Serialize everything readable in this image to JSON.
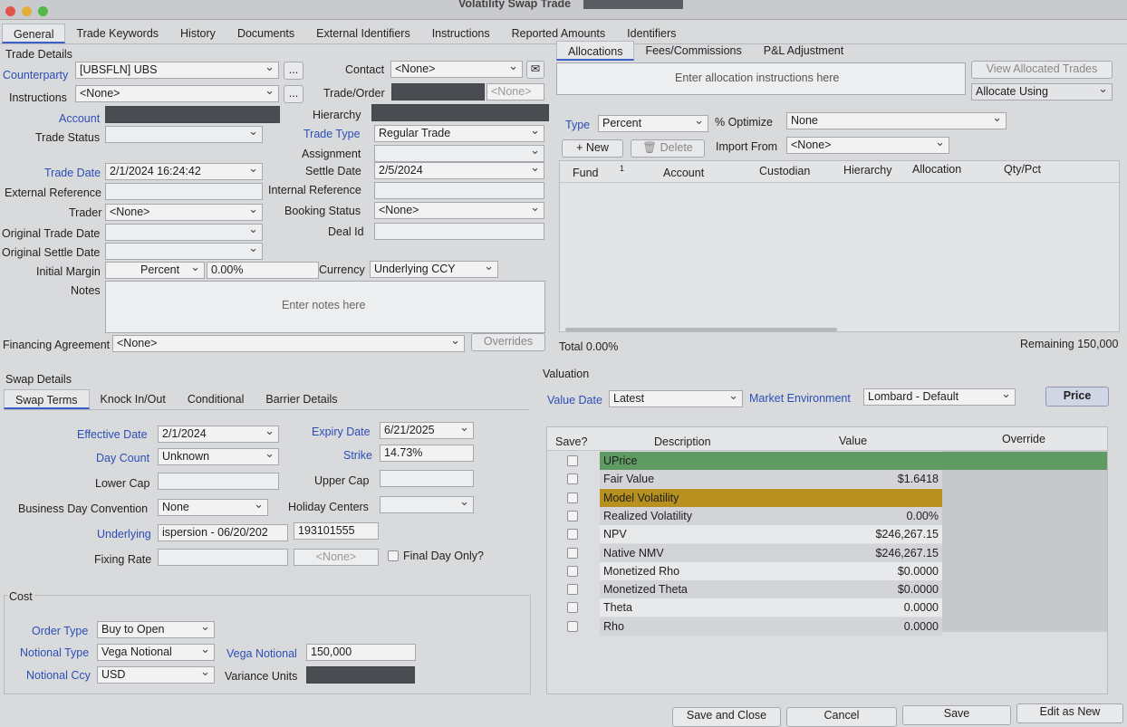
{
  "window": {
    "title": "Volatility Swap Trade"
  },
  "tabs": [
    "General",
    "Trade Keywords",
    "History",
    "Documents",
    "External Identifiers",
    "Instructions",
    "Reported Amounts",
    "Identifiers"
  ],
  "trade_details": {
    "section_title": "Trade Details",
    "counterparty_label": "Counterparty",
    "counterparty": "[UBSFLN] UBS",
    "contact_label": "Contact",
    "contact": "<None>",
    "instructions_label": "Instructions",
    "instructions": "<None>",
    "trade_order_label": "Trade/Order",
    "trade_order": "<None>",
    "account_label": "Account",
    "hierarchy_label": "Hierarchy",
    "trade_status_label": "Trade Status",
    "trade_type_label": "Trade Type",
    "trade_type": "Regular Trade",
    "assignment_label": "Assignment",
    "trade_date_label": "Trade Date",
    "trade_date": "2/1/2024 16:24:42",
    "settle_date_label": "Settle Date",
    "settle_date": "2/5/2024",
    "external_ref_label": "External Reference",
    "internal_ref_label": "Internal Reference",
    "trader_label": "Trader",
    "trader": "<None>",
    "booking_status_label": "Booking Status",
    "booking_status": "<None>",
    "original_trade_date_label": "Original Trade Date",
    "deal_id_label": "Deal Id",
    "original_settle_date_label": "Original Settle Date",
    "initial_margin_label": "Initial Margin",
    "initial_margin_type": "Percent",
    "initial_margin_value": "0.00%",
    "currency_label": "Currency",
    "currency": "Underlying CCY",
    "notes_label": "Notes",
    "notes_placeholder": "Enter notes here",
    "financing_label": "Financing Agreement",
    "financing": "<None>",
    "overrides_button": "Overrides",
    "ellipsis": "..."
  },
  "allocations": {
    "tabs": [
      "Allocations",
      "Fees/Commissions",
      "P&L Adjustment"
    ],
    "instructions_placeholder": "Enter allocation instructions here",
    "view_allocated_button": "View Allocated Trades",
    "allocate_using": "Allocate Using",
    "type_label": "Type",
    "type": "Percent",
    "optimize_label": "% Optimize",
    "optimize": "None",
    "new_button": "+ New",
    "delete_button": "Delete",
    "import_from_label": "Import From",
    "import_from": "<None>",
    "columns": [
      "Fund",
      "Account",
      "Custodian",
      "Hierarchy",
      "Allocation",
      "Qty/Pct"
    ],
    "sort_indicator": "1",
    "total": "Total 0.00%",
    "remaining": "Remaining 150,000"
  },
  "swap_details": {
    "section_title": "Swap Details",
    "tabs": [
      "Swap Terms",
      "Knock In/Out",
      "Conditional",
      "Barrier Details"
    ],
    "effective_date_label": "Effective Date",
    "effective_date": "2/1/2024",
    "expiry_date_label": "Expiry Date",
    "expiry_date": "6/21/2025",
    "day_count_label": "Day Count",
    "day_count": "Unknown",
    "strike_label": "Strike",
    "strike": "14.73%",
    "lower_cap_label": "Lower Cap",
    "upper_cap_label": "Upper Cap",
    "bdc_label": "Business Day Convention",
    "bdc": "None",
    "holiday_centers_label": "Holiday Centers",
    "underlying_label": "Underlying",
    "underlying": "ispersion - 06/20/202",
    "underlying_id": "193101555",
    "fixing_rate_label": "Fixing Rate",
    "fixing_rate_placeholder": "<None>",
    "final_day_only_label": "Final Day Only?"
  },
  "cost": {
    "section_title": "Cost",
    "order_type_label": "Order Type",
    "order_type": "Buy to Open",
    "notional_type_label": "Notional Type",
    "notional_type": "Vega Notional",
    "vega_notional_label": "Vega Notional",
    "vega_notional": "150,000",
    "notional_ccy_label": "Notional Ccy",
    "notional_ccy": "USD",
    "variance_units_label": "Variance Units"
  },
  "valuation": {
    "section_title": "Valuation",
    "value_date_label": "Value Date",
    "value_date": "Latest",
    "market_env_label": "Market Environment",
    "market_env": "Lombard - Default",
    "price_button": "Price",
    "columns": [
      "Save?",
      "Description",
      "Value",
      "Override"
    ],
    "rows": [
      {
        "description": "UPrice",
        "value": ""
      },
      {
        "description": "Fair Value",
        "value": "$1.6418"
      },
      {
        "description": "Model Volatility",
        "value": ""
      },
      {
        "description": "Realized Volatility",
        "value": "0.00%"
      },
      {
        "description": "NPV",
        "value": "$246,267.15"
      },
      {
        "description": "Native NMV",
        "value": "$246,267.15"
      },
      {
        "description": "Monetized Rho",
        "value": "$0.0000"
      },
      {
        "description": "Monetized Theta",
        "value": "$0.0000"
      },
      {
        "description": "Theta",
        "value": "0.0000"
      },
      {
        "description": "Rho",
        "value": "0.0000"
      }
    ],
    "highlight_colors": {
      "uprice": "#5f9a63",
      "model_volatility": "#b7901f"
    }
  },
  "footer": {
    "save_close": "Save and Close",
    "cancel": "Cancel",
    "save": "Save",
    "edit_as_new": "Edit as New"
  }
}
